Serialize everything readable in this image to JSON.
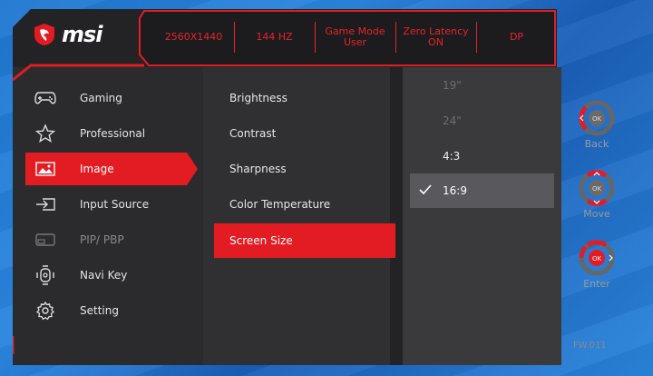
{
  "brand": {
    "name": "msi"
  },
  "status_bar": [
    {
      "line1": "2560X1440",
      "line2": ""
    },
    {
      "line1": "144 HZ",
      "line2": ""
    },
    {
      "line1": "Game Mode",
      "line2": "User"
    },
    {
      "line1": "Zero Latency",
      "line2": "ON"
    },
    {
      "line1": "DP",
      "line2": ""
    }
  ],
  "menu": {
    "items": [
      {
        "label": "Gaming",
        "icon": "gamepad-icon"
      },
      {
        "label": "Professional",
        "icon": "star-icon"
      },
      {
        "label": "Image",
        "icon": "image-icon"
      },
      {
        "label": "Input Source",
        "icon": "input-source-icon"
      },
      {
        "label": "PIP/ PBP",
        "icon": "pip-icon"
      },
      {
        "label": "Navi Key",
        "icon": "navi-key-icon"
      },
      {
        "label": "Setting",
        "icon": "gear-icon"
      }
    ],
    "active": "Image"
  },
  "submenu": {
    "items": [
      "Brightness",
      "Contrast",
      "Sharpness",
      "Color Temperature",
      "Screen Size"
    ],
    "selected": "Screen Size"
  },
  "options": {
    "items": [
      "19\"",
      "24\"",
      "4:3",
      "16:9"
    ],
    "checked": "16:9"
  },
  "controls": {
    "back": "Back",
    "move": "Move",
    "enter": "Enter",
    "ok": "OK"
  },
  "firmware": "FW.011",
  "colors": {
    "accent": "#e31c23",
    "panel": "#2f2f31",
    "frame": "#232325"
  }
}
